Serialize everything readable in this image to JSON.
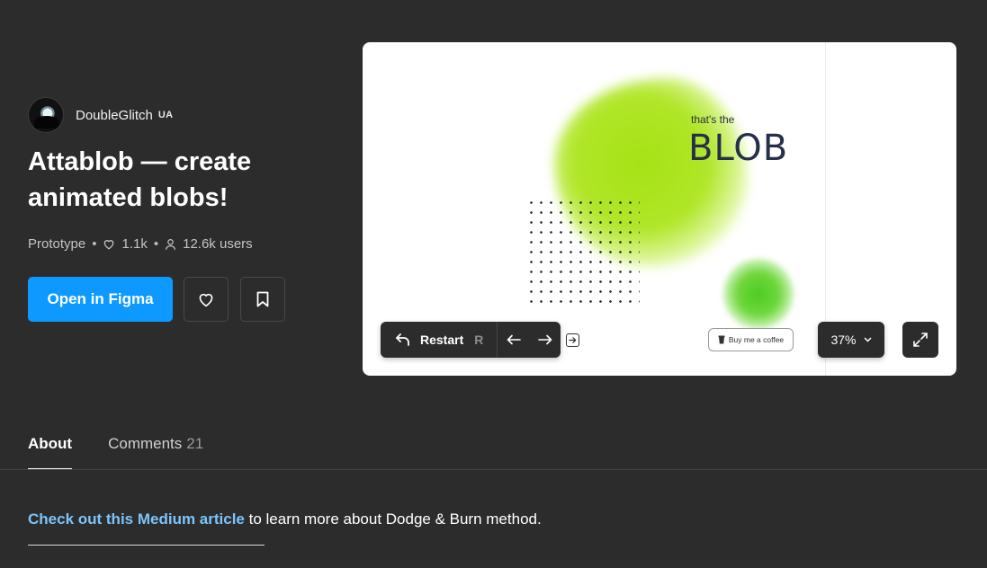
{
  "author": {
    "name": "DoubleGlitch",
    "tag": "UA"
  },
  "file": {
    "title": "Attablob — create animated blobs!",
    "type": "Prototype",
    "likes": "1.1k",
    "users": "12.6k users"
  },
  "actions": {
    "open_label": "Open in Figma"
  },
  "preview": {
    "thats_the": "that's the",
    "blob_word": "BLOB",
    "restart_label": "Restart",
    "restart_key": "R",
    "coffee_label": "Buy me a coffee",
    "zoom": "37%"
  },
  "tabs": [
    {
      "label": "About",
      "count": ""
    },
    {
      "label": "Comments",
      "count": "21"
    }
  ],
  "about": {
    "link_text": "Check out this Medium article",
    "rest_text": " to learn more about Dodge & Burn method."
  },
  "colors": {
    "accent": "#0d99ff",
    "link": "#7cc4fa",
    "background": "#2c2c2c"
  },
  "icons": [
    "heart-icon",
    "bookmark-icon",
    "user-icon",
    "undo-icon",
    "arrow-left-icon",
    "arrow-right-icon",
    "exit-icon",
    "coffee-icon",
    "chevron-down-icon",
    "expand-icon"
  ]
}
